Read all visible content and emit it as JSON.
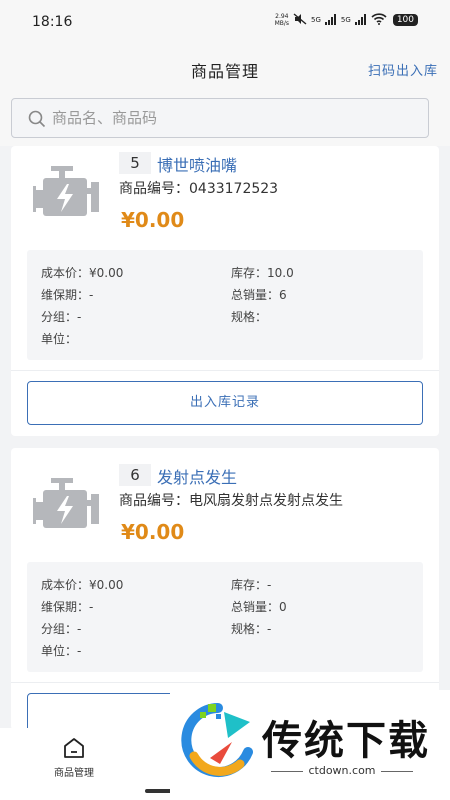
{
  "status_bar": {
    "time": "18:16",
    "net_speed": "2.94\nMB/s",
    "signal_1": "5G",
    "signal_2": "5G",
    "battery": "100"
  },
  "header": {
    "title": "商品管理",
    "action": "扫码出入库"
  },
  "search": {
    "placeholder": "商品名、商品码"
  },
  "labels": {
    "code": "商品编号：",
    "cost": "成本价：",
    "warranty": "维保期：",
    "group": "分组：",
    "unit": "单位：",
    "stock": "库存：",
    "sales": "总销量：",
    "spec": "规格：",
    "record_button": "出入库记录"
  },
  "products": [
    {
      "index": "5",
      "name": "博世喷油嘴",
      "code": "0433172523",
      "price": "¥0.00",
      "cost": "¥0.00",
      "warranty": "-",
      "group": "-",
      "unit": "",
      "stock": "10.0",
      "sales": "6",
      "spec": ""
    },
    {
      "index": "6",
      "name": "发射点发生",
      "code": "电风扇发射点发射点发生",
      "price": "¥0.00",
      "cost": "¥0.00",
      "warranty": "-",
      "group": "-",
      "unit": "-",
      "stock": "-",
      "sales": "0",
      "spec": "-"
    }
  ],
  "tabbar": {
    "home_label": "商品管理"
  },
  "watermark": {
    "text": "传统下载",
    "url": "ctdown.com"
  },
  "colors": {
    "accent": "#3b6fb6",
    "price": "#e08a18",
    "icon_gray": "#b5b7bb"
  }
}
